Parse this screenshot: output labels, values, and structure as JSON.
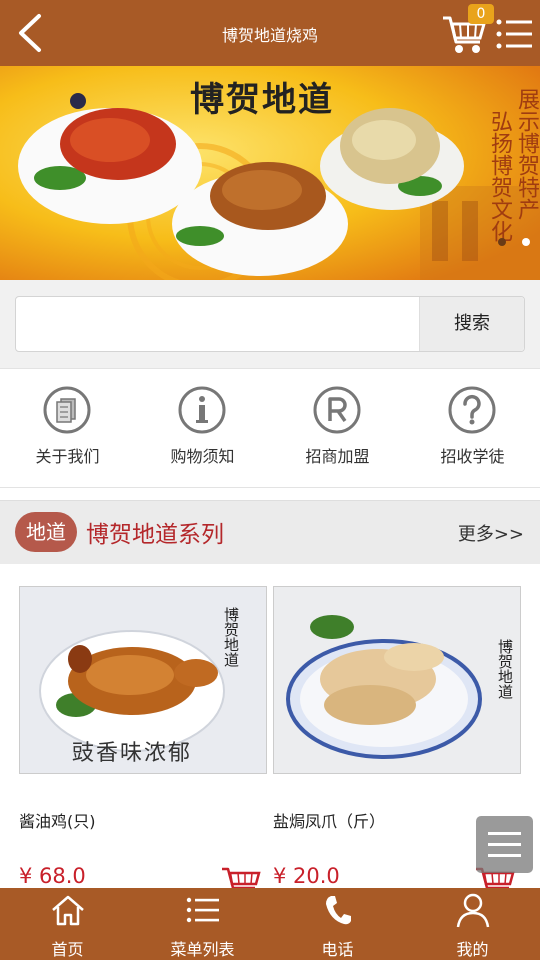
{
  "header": {
    "title": "博贺地道烧鸡",
    "back_icon": "back-arrow-icon",
    "cart_icon": "cart-icon",
    "cart_count": "0",
    "menu_icon": "menu-list-icon"
  },
  "banner": {
    "title": "博贺地道",
    "slogan_line1": "展示博贺特产",
    "slogan_line2": "弘扬博贺文化",
    "slide_count": 2,
    "active_slide": 1
  },
  "search": {
    "value": "",
    "placeholder": "",
    "button_label": "搜索"
  },
  "quick_nav": [
    {
      "label": "关于我们",
      "icon": "document-icon"
    },
    {
      "label": "购物须知",
      "icon": "info-icon"
    },
    {
      "label": "招商加盟",
      "icon": "registered-icon"
    },
    {
      "label": "招收学徒",
      "icon": "question-icon"
    }
  ],
  "section": {
    "badge": "地道",
    "title": "博贺地道系列",
    "more": "更多>>"
  },
  "products": [
    {
      "name": "酱油鸡(只)",
      "price": "¥ 68.0",
      "img_text_v": "博贺地道",
      "img_text_h": "豉香味浓郁"
    },
    {
      "name": "盐焗凤爪（斤）",
      "price": "¥ 20.0",
      "img_text_v": "博贺地道"
    }
  ],
  "bottom_nav": [
    {
      "label": "首页",
      "icon": "home-icon"
    },
    {
      "label": "菜单列表",
      "icon": "list-icon"
    },
    {
      "label": "电话",
      "icon": "phone-icon"
    },
    {
      "label": "我的",
      "icon": "user-icon"
    }
  ],
  "colors": {
    "brand": "#a85a26",
    "price": "#c8202a",
    "section_title": "#b4272a",
    "badge": "#b5594b",
    "cart_badge": "#e9a31b"
  }
}
